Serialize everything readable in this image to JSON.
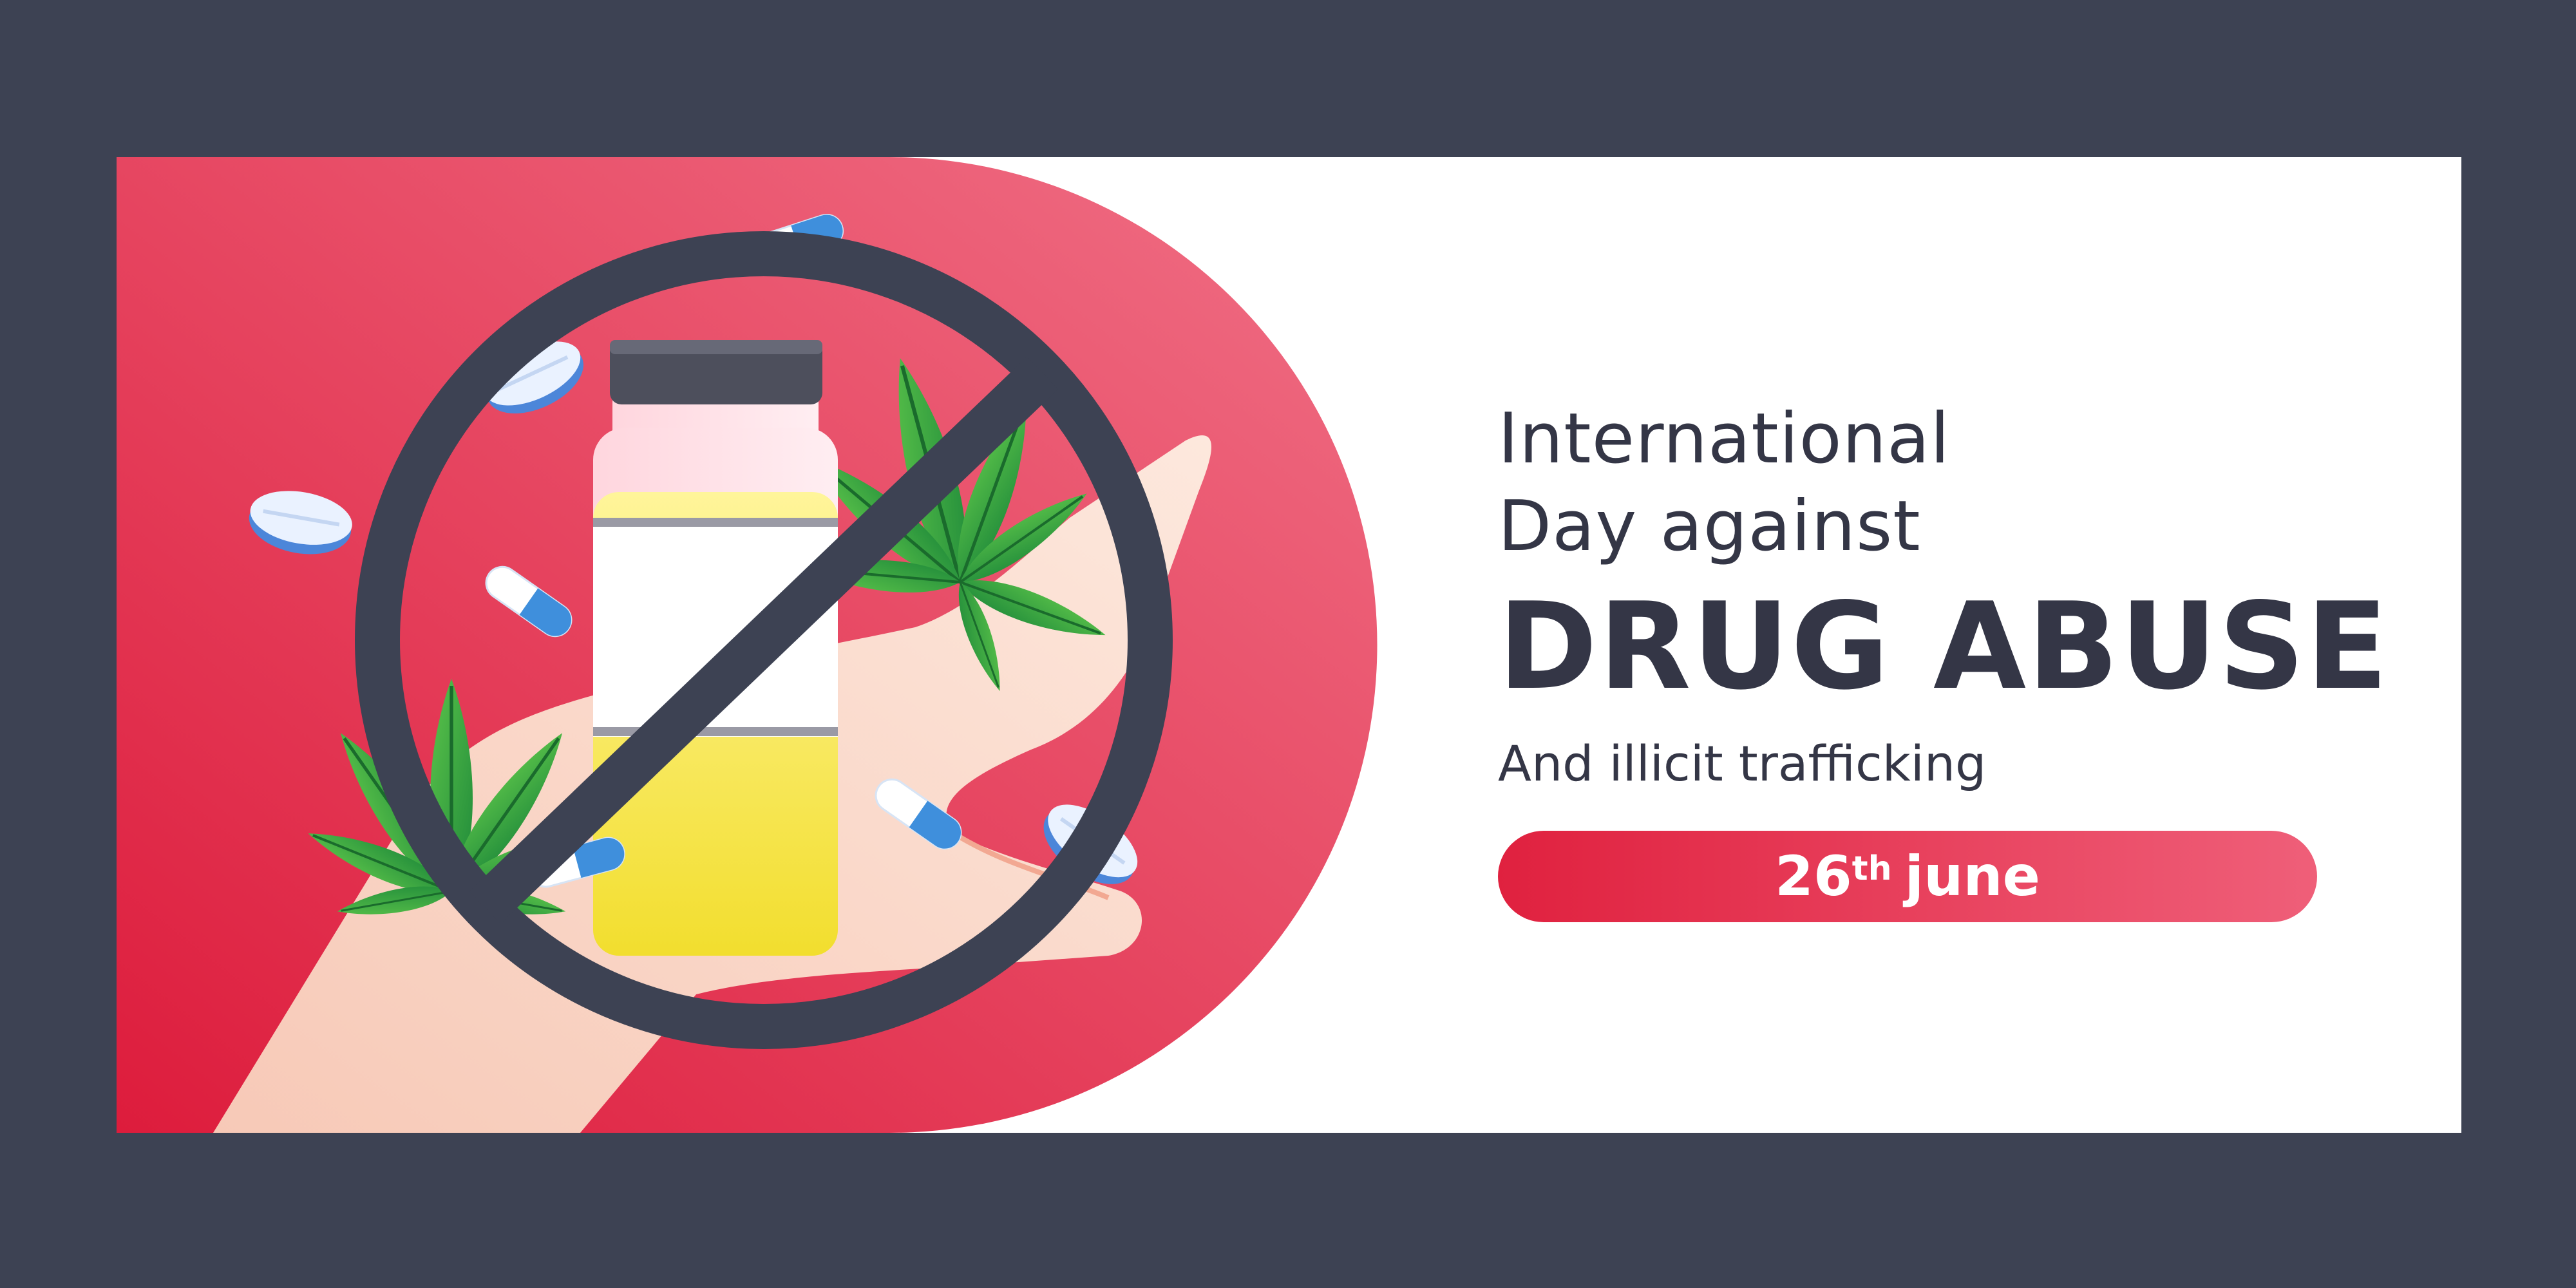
{
  "banner": {
    "title_line1": "International",
    "title_line2": "Day against",
    "headline": "DRUG ABUSE",
    "subtitle": "And illicit trafficking",
    "date_day": "26",
    "date_suffix": "th",
    "date_month": "june"
  },
  "colors": {
    "frame": "#3d4253",
    "card": "#ffffff",
    "text_dark": "#343646",
    "accent_red": "#e0213f",
    "accent_pink": "#ef5f79",
    "pill_text": "#ffffff"
  },
  "illustration": {
    "icons": [
      "no-entry-sign-icon",
      "medicine-bottle-icon",
      "cannabis-leaf-icon",
      "capsule-pill-icon",
      "tablet-pill-icon",
      "open-hand-icon"
    ]
  }
}
